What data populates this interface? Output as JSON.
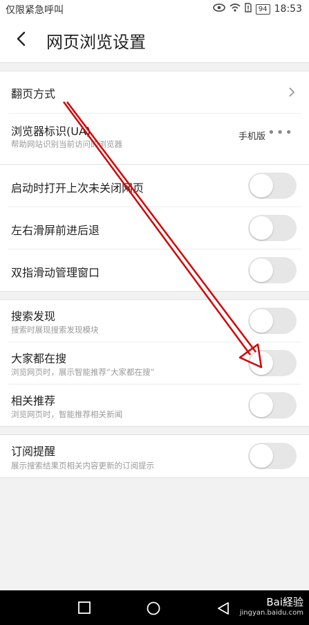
{
  "status_bar": {
    "left_text": "仅限紧急呼叫",
    "battery": "94",
    "time": "18:53"
  },
  "header": {
    "title": "网页浏览设置"
  },
  "groups": [
    {
      "rows": [
        {
          "title": "翻页方式",
          "control": "chevron"
        },
        {
          "title": "浏览器标识(UA)",
          "subtitle": "帮助网站识别当前访问的浏览器",
          "value": "手机版",
          "control": "more"
        }
      ]
    },
    {
      "rows": [
        {
          "title": "启动时打开上次未关闭网页",
          "control": "toggle",
          "on": false
        },
        {
          "title": "左右滑屏前进后退",
          "control": "toggle",
          "on": false
        },
        {
          "title": "双指滑动管理窗口",
          "control": "toggle",
          "on": false
        }
      ]
    },
    {
      "rows": [
        {
          "title": "搜索发现",
          "subtitle": "搜索时展现搜索发现模块",
          "control": "toggle",
          "on": false
        },
        {
          "title": "大家都在搜",
          "subtitle": "浏览网页时，展示智能推荐“大家都在搜”",
          "control": "toggle",
          "on": false
        },
        {
          "title": "相关推荐",
          "subtitle": "浏览网页时，智能推荐相关新闻",
          "control": "toggle",
          "on": false
        }
      ]
    },
    {
      "rows": [
        {
          "title": "订阅提醒",
          "subtitle": "展示搜索结果页相关内容更新的订阅提示",
          "control": "toggle",
          "on": false
        }
      ]
    }
  ],
  "watermark": {
    "brand": "Bai経验",
    "url": "jingyan.baidu.com"
  },
  "colors": {
    "annotation_arrow": "#d40000",
    "toggle_off": "#e6e6e6"
  }
}
